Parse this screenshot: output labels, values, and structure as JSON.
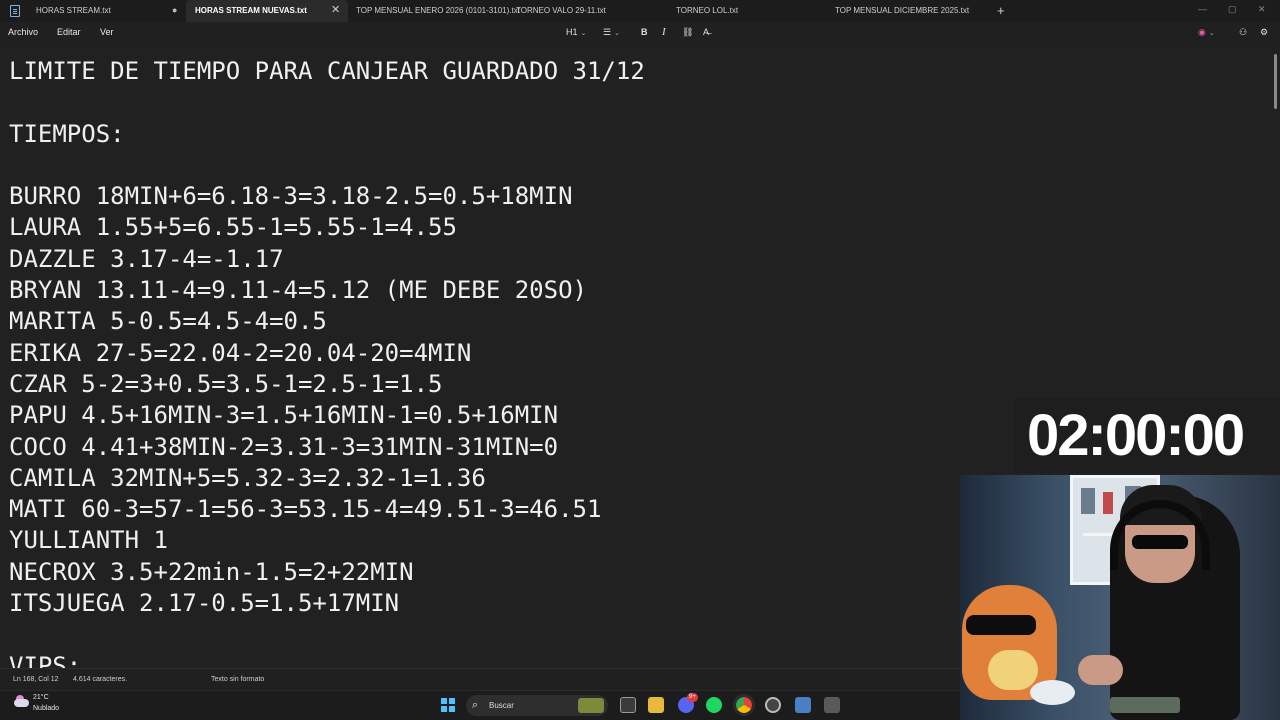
{
  "tabs": [
    {
      "label": "HORAS STREAM.txt"
    },
    {
      "label": "HORAS STREAM NUEVAS.txt"
    },
    {
      "label": "TOP MENSUAL ENERO 2026 (0101-3101).txt"
    },
    {
      "label": "TORNEO VALO 29-11.txt"
    },
    {
      "label": "TORNEO LOL.txt"
    },
    {
      "label": "TOP MENSUAL DICIEMBRE 2025.txt"
    }
  ],
  "menu": {
    "archivo": "Archivo",
    "editar": "Editar",
    "ver": "Ver"
  },
  "toolbar": {
    "heading": "H1",
    "bold": "B",
    "italic": "I"
  },
  "document_lines": [
    "LIMITE DE TIEMPO PARA CANJEAR GUARDADO 31/12",
    "",
    "TIEMPOS:",
    "",
    "BURRO 18MIN+6=6.18-3=3.18-2.5=0.5+18MIN",
    "LAURA 1.55+5=6.55-1=5.55-1=4.55",
    "DAZZLE 3.17-4=-1.17",
    "BRYAN 13.11-4=9.11-4=5.12 (ME DEBE 20SO)",
    "MARITA 5-0.5=4.5-4=0.5",
    "ERIKA 27-5=22.04-2=20.04-20=4MIN",
    "CZAR 5-2=3+0.5=3.5-1=2.5-1=1.5",
    "PAPU 4.5+16MIN-3=1.5+16MIN-1=0.5+16MIN",
    "COCO 4.41+38MIN-2=3.31-3=31MIN-31MIN=0",
    "CAMILA 32MIN+5=5.32-3=2.32-1=1.36",
    "MATI 60-3=57-1=56-3=53.15-4=49.51-3=46.51",
    "YULLIANTH 1",
    "NECROX 3.5+22min-1.5=2+22MIN",
    "ITSJUEGA 2.17-0.5=1.5+17MIN",
    "",
    "VIPS:"
  ],
  "status": {
    "position": "Ln 168, Col 12",
    "char_count": "4.614 caracteres.",
    "format": "Texto sin formato"
  },
  "timer": "02:00:00",
  "weather": {
    "temp": "21°C",
    "condition": "Nublado"
  },
  "taskbar": {
    "search_label": "Buscar",
    "discord_badge": "9+"
  },
  "colors": {
    "accent": "#4cc2ff",
    "editor_bg": "#212121",
    "text": "#f0f0f0"
  }
}
